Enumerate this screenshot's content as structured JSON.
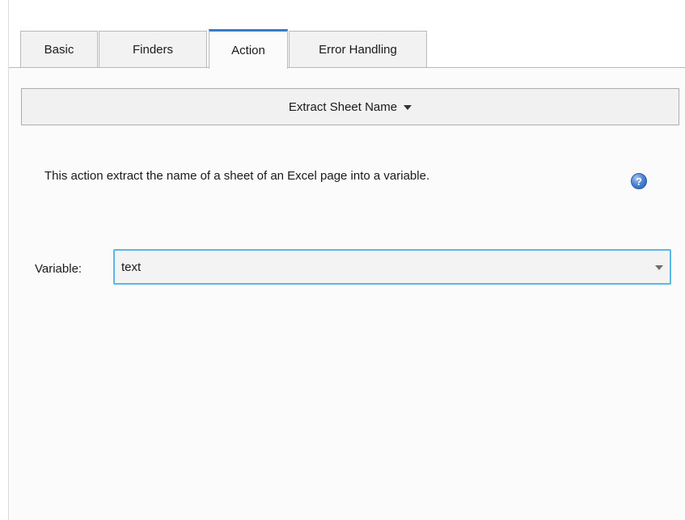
{
  "tabs": [
    {
      "label": "Basic"
    },
    {
      "label": "Finders"
    },
    {
      "label": "Action"
    },
    {
      "label": "Error Handling"
    }
  ],
  "active_tab": "Action",
  "action": {
    "selected": "Extract Sheet Name",
    "description": "This action extract the name of a sheet of an Excel page into a variable.",
    "help_icon": "question-icon"
  },
  "variable": {
    "label": "Variable:",
    "value": "text"
  },
  "colors": {
    "accent_tab": "#3a7bc8",
    "focus_border": "#5bb8e6",
    "help_icon": "#4f86d6"
  }
}
